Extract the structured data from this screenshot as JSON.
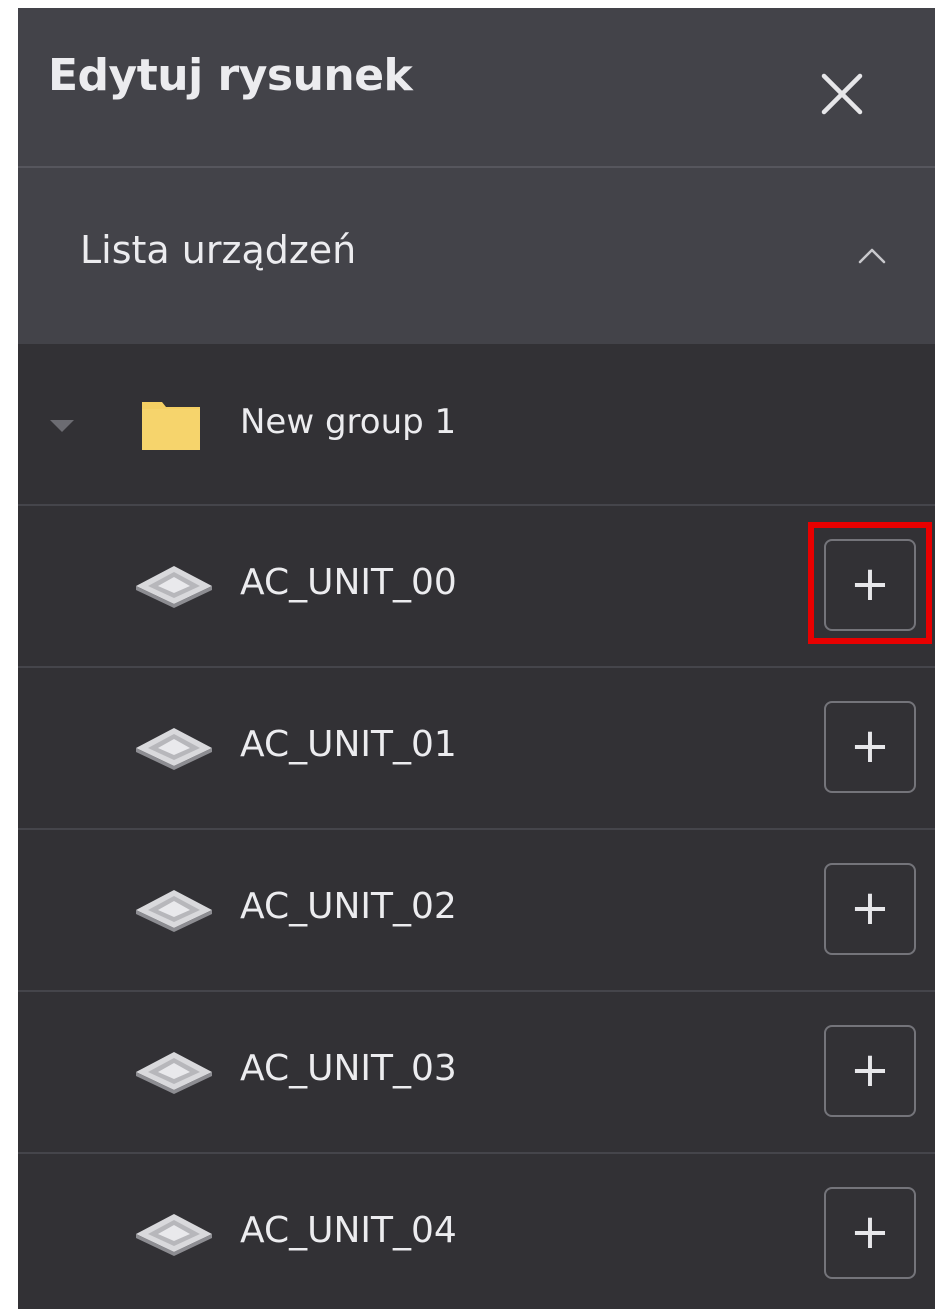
{
  "header": {
    "title": "Edytuj rysunek",
    "close_icon": "close-icon"
  },
  "device_list": {
    "section_title": "Lista urządzeń",
    "collapse_icon": "chevron-up-icon",
    "group": {
      "label": "New group 1",
      "expand_icon": "caret-down-icon",
      "folder_icon": "folder-icon",
      "folder_color": "#f4cf63"
    },
    "devices": [
      {
        "label": "AC_UNIT_00",
        "add_label": "+"
      },
      {
        "label": "AC_UNIT_01",
        "add_label": "+"
      },
      {
        "label": "AC_UNIT_02",
        "add_label": "+"
      },
      {
        "label": "AC_UNIT_03",
        "add_label": "+"
      },
      {
        "label": "AC_UNIT_04",
        "add_label": "+"
      }
    ]
  },
  "highlight": {
    "target": "AC_UNIT_00 add button",
    "color": "#e80000"
  },
  "colors": {
    "header_bg": "#434349",
    "list_bg": "#323135",
    "text": "#ececef"
  }
}
